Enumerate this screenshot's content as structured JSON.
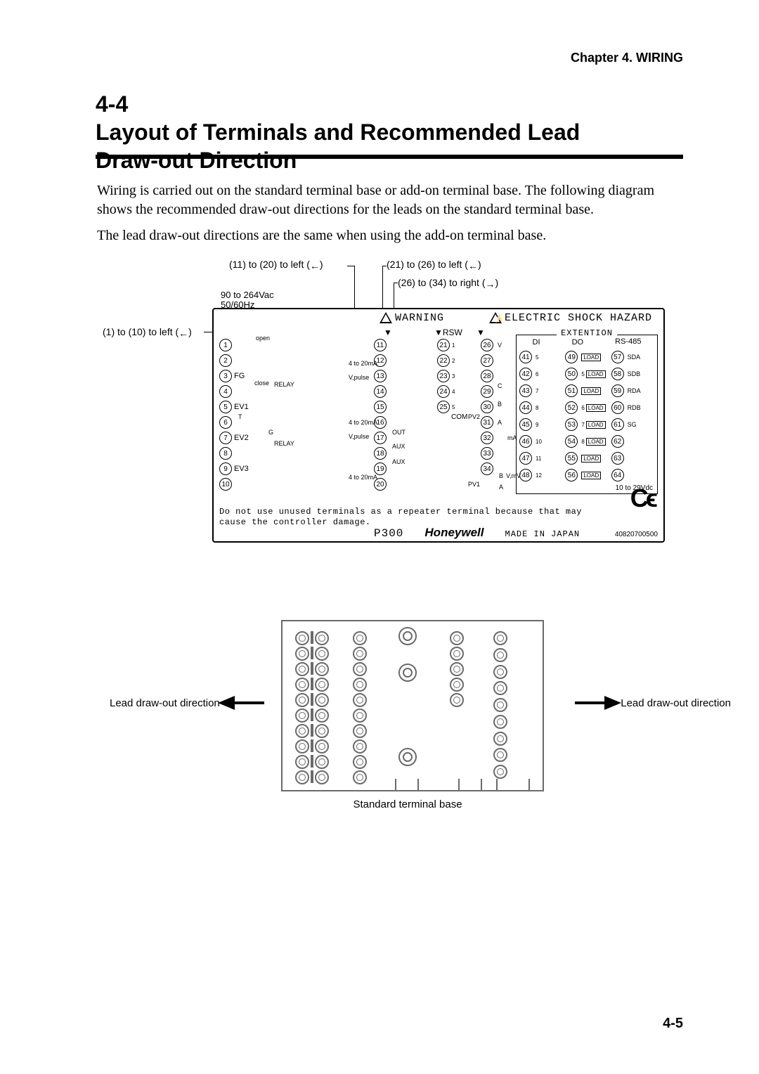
{
  "header": {
    "chapter": "Chapter 4. WIRING"
  },
  "section": {
    "number": "4-4",
    "title": "Layout of Terminals and Recommended Lead Draw-out Direction"
  },
  "paragraphs": {
    "p1": "Wiring is carried out on the standard terminal base or add-on terminal base. The following diagram shows the recommended draw-out directions for the leads on the standard terminal base.",
    "p2": "The lead draw-out directions are the same when using the add-on terminal base."
  },
  "diagram1": {
    "annot": {
      "a11_20": "(11) to (20)  to left (",
      "a21_26": "(21) to (26) to left (",
      "a26_34": "(26) to (34) to right (",
      "a1_10": "(1)  to (10) to left (",
      "close": ")"
    },
    "voltage_line1": "90 to 264Vac",
    "voltage_line2": "50/60Hz",
    "warning": "WARNING",
    "shock": "ELECTRIC SHOCK HAZARD",
    "rsw": "RSW",
    "ext_title": "EXTENTION",
    "ext_di": "DI",
    "ext_do": "DO",
    "ext_rs": "RS-485",
    "load": "LOAD",
    "vdc": "10 to 29Vdc",
    "ce": "CE",
    "note_l1": "Do not use unused terminals as a repeater terminal because that may",
    "note_l2": "cause the controller damage.",
    "model": "P300",
    "brand": "Honeywell",
    "made": "MADE IN JAPAN",
    "code": "40820700500",
    "colA_side": [
      "",
      "",
      "FG",
      "",
      "EV1",
      "",
      "EV2",
      "",
      "EV3",
      ""
    ],
    "hints": {
      "open": "open",
      "close": "close",
      "relay": "RELAY",
      "i420": "4 to 20mA",
      "vpulse": "V,pulse",
      "out": "OUT",
      "aux": "AUX",
      "com": "COM",
      "pv1": "PV1",
      "pv2": "PV2",
      "mA": "mA",
      "vmv": "V,mV",
      "g": "G",
      "t": "T",
      "c": "C",
      "b": "B",
      "a": "A",
      "v": "V"
    },
    "ext_rows": [
      {
        "di": "41",
        "di_sub": "5",
        "do": "49",
        "rs": "57",
        "rs_lbl": "SDA"
      },
      {
        "di": "42",
        "di_sub": "6",
        "do": "50",
        "do_sub": "5",
        "rs": "58",
        "rs_lbl": "SDB"
      },
      {
        "di": "43",
        "di_sub": "7",
        "do": "51",
        "rs": "59",
        "rs_lbl": "RDA"
      },
      {
        "di": "44",
        "di_sub": "8",
        "do": "52",
        "do_sub": "6",
        "rs": "60",
        "rs_lbl": "RDB"
      },
      {
        "di": "45",
        "di_sub": "9",
        "do": "53",
        "do_sub": "7",
        "rs": "61",
        "rs_lbl": "SG"
      },
      {
        "di": "46",
        "di_sub": "10",
        "do": "54",
        "do_sub": "8",
        "rs": "62",
        "rs_lbl": ""
      },
      {
        "di": "47",
        "di_sub": "11",
        "do": "55",
        "rs": "63",
        "rs_lbl": ""
      },
      {
        "di": "48",
        "di_sub": "12",
        "do": "56",
        "rs": "64",
        "rs_lbl": ""
      }
    ]
  },
  "diagram2": {
    "label_left": "Lead draw-out direction",
    "label_right": "Lead draw-out direction",
    "caption": "Standard terminal base"
  },
  "footer": {
    "page": "4-5"
  }
}
